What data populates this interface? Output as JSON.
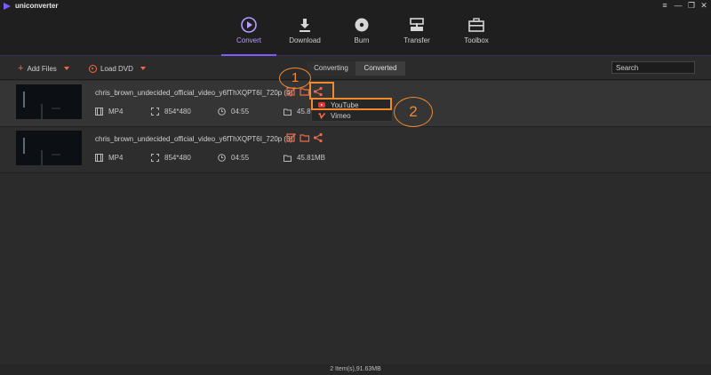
{
  "app": {
    "title": "uniconverter"
  },
  "window_controls": [
    "≡",
    "—",
    "❐",
    "✕"
  ],
  "nav": {
    "items": [
      {
        "label": "Convert",
        "icon": "convert-icon",
        "active": true
      },
      {
        "label": "Download",
        "icon": "download-icon",
        "active": false
      },
      {
        "label": "Burn",
        "icon": "burn-icon",
        "active": false
      },
      {
        "label": "Transfer",
        "icon": "transfer-icon",
        "active": false
      },
      {
        "label": "Toolbox",
        "icon": "toolbox-icon",
        "active": false
      }
    ]
  },
  "toolbar": {
    "add_files": "Add Files",
    "load_dvd": "Load DVD",
    "tab_converting": "Converting",
    "tab_converted": "Converted",
    "search_placeholder": "Search"
  },
  "files": [
    {
      "name": "chris_brown_undecided_official_video_y6fThXQPT6I_720p (4)",
      "format": "MP4",
      "resolution": "854*480",
      "duration": "04:55",
      "size": "45.81"
    },
    {
      "name": "chris_brown_undecided_official_video_y6fThXQPT6I_720p (3)",
      "format": "MP4",
      "resolution": "854*480",
      "duration": "04:55",
      "size": "45.81MB"
    }
  ],
  "share_menu": {
    "youtube": "YouTube",
    "vimeo": "Vimeo"
  },
  "annotations": {
    "step1": "1",
    "step2": "2"
  },
  "status": {
    "summary": "2 Item(s),91.63MB"
  },
  "colors": {
    "accent": "#7d5cff",
    "action": "#f06a4a",
    "annotation": "#f08a2e",
    "youtube": "#e5352d",
    "vimeo": "#f06a4a"
  }
}
